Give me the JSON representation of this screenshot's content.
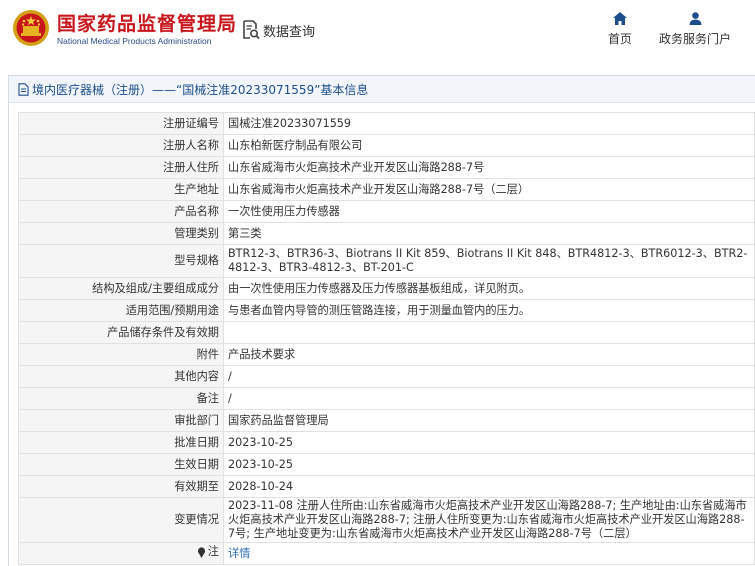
{
  "header": {
    "site_name_cn": "国家药品监督管理局",
    "site_name_en": "National Medical Products Administration",
    "search_title": "数据查询",
    "nav": {
      "home": "首页",
      "service": "政务服务门户"
    },
    "brand_color": "#c8161d",
    "accent_color": "#1f4e8c"
  },
  "panel": {
    "title": "境内医疗器械（注册）——“国械注准20233071559”基本信息"
  },
  "rows": [
    {
      "label": "注册证编号",
      "value": "国械注准20233071559"
    },
    {
      "label": "注册人名称",
      "value": "山东柏新医疗制品有限公司"
    },
    {
      "label": "注册人住所",
      "value": "山东省威海市火炬高技术产业开发区山海路288-7号"
    },
    {
      "label": "生产地址",
      "value": "山东省威海市火炬高技术产业开发区山海路288-7号（二层）"
    },
    {
      "label": "产品名称",
      "value": "一次性使用压力传感器"
    },
    {
      "label": "管理类别",
      "value": "第三类"
    },
    {
      "label": "型号规格",
      "value": "BTR12-3、BTR36-3、Biotrans II Kit 859、Biotrans II Kit 848、BTR4812-3、BTR6012-3、BTR2-4812-3、BTR3-4812-3、BT-201-C"
    },
    {
      "label": "结构及组成/主要组成成分",
      "value": "由一次性使用压力传感器及压力传感器基板组成，详见附页。"
    },
    {
      "label": "适用范围/预期用途",
      "value": "与患者血管内导管的测压管路连接，用于测量血管内的压力。"
    },
    {
      "label": "产品储存条件及有效期",
      "value": ""
    },
    {
      "label": "附件",
      "value": "产品技术要求"
    },
    {
      "label": "其他内容",
      "value": "/"
    },
    {
      "label": "备注",
      "value": "/"
    },
    {
      "label": "审批部门",
      "value": "国家药品监督管理局"
    },
    {
      "label": "批准日期",
      "value": "2023-10-25"
    },
    {
      "label": "生效日期",
      "value": "2023-10-25"
    },
    {
      "label": "有效期至",
      "value": "2028-10-24"
    },
    {
      "label": "变更情况",
      "value": "2023-11-08 注册人住所由:山东省威海市火炬高技术产业开发区山海路288-7; 生产地址由:山东省威海市火炬高技术产业开发区山海路288-7; 注册人住所变更为:山东省威海市火炬高技术产业开发区山海路288-7号; 生产地址变更为:山东省威海市火炬高技术产业开发区山海路288-7号（二层）"
    },
    {
      "label": "注",
      "value": "详情"
    }
  ],
  "icons": {
    "emblem": "national-emblem-icon",
    "search": "document-search-icon",
    "home": "home-icon",
    "service": "user-icon",
    "title": "document-icon",
    "note": "pin-icon"
  }
}
